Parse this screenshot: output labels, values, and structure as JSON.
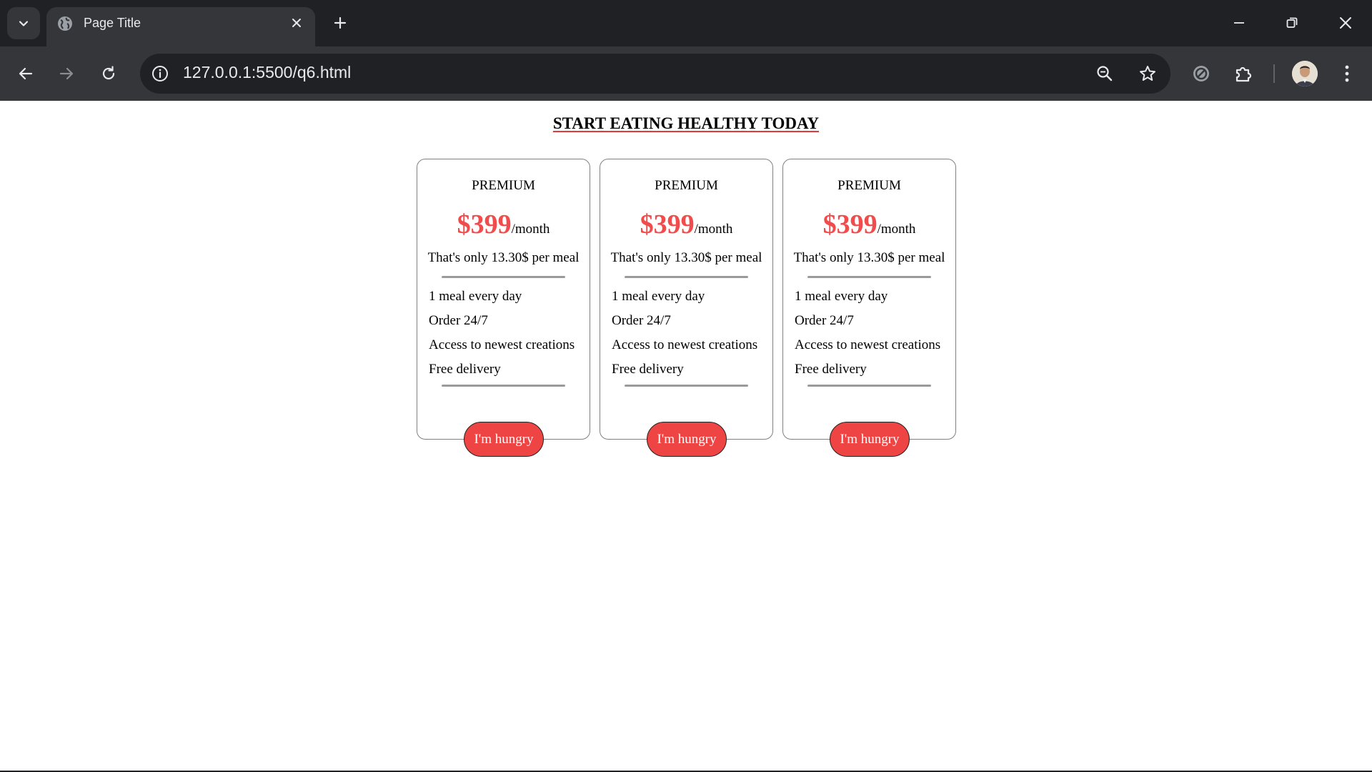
{
  "browser": {
    "tab_title": "Page Title",
    "url": "127.0.0.1:5500/q6.html"
  },
  "page": {
    "headline": "START EATING HEALTHY TODAY",
    "plans": [
      {
        "name": "PREMIUM",
        "price": "$399",
        "period": "/month",
        "per_meal": "That's only 13.30$ per meal",
        "features": [
          "1 meal every day",
          "Order 24/7",
          "Access to newest creations",
          "Free delivery"
        ],
        "button": "I'm hungry"
      },
      {
        "name": "PREMIUM",
        "price": "$399",
        "period": "/month",
        "per_meal": "That's only 13.30$ per meal",
        "features": [
          "1 meal every day",
          "Order 24/7",
          "Access to newest creations",
          "Free delivery"
        ],
        "button": "I'm hungry"
      },
      {
        "name": "PREMIUM",
        "price": "$399",
        "period": "/month",
        "per_meal": "That's only 13.30$ per meal",
        "features": [
          "1 meal every day",
          "Order 24/7",
          "Access to newest creations",
          "Free delivery"
        ],
        "button": "I'm hungry"
      }
    ]
  },
  "colors": {
    "accent": "#ee4444",
    "price": "#f24b4b",
    "chrome_dark": "#202124",
    "chrome_toolbar": "#35363a"
  },
  "icons": [
    "chevron-down-icon",
    "globe-icon",
    "close-icon",
    "plus-icon",
    "minimize-icon",
    "restore-icon",
    "window-close-icon",
    "back-arrow-icon",
    "forward-arrow-icon",
    "reload-icon",
    "info-icon",
    "zoom-icon",
    "star-icon",
    "blocked-icon",
    "puzzle-icon",
    "kebab-menu-icon"
  ]
}
